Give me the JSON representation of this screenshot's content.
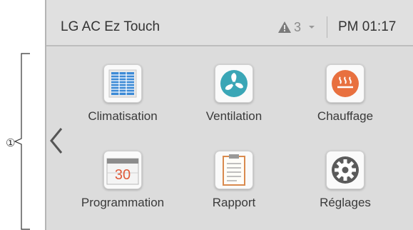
{
  "annotation": {
    "callout": "①"
  },
  "header": {
    "title": "LG AC Ez Touch",
    "alert_count": "3",
    "time": "PM 01:17"
  },
  "menu": {
    "items": [
      {
        "label": "Climatisation",
        "icon": "air-conditioner-icon"
      },
      {
        "label": "Ventilation",
        "icon": "fan-icon"
      },
      {
        "label": "Chauffage",
        "icon": "heating-icon"
      },
      {
        "label": "Programmation",
        "icon": "calendar-icon"
      },
      {
        "label": "Rapport",
        "icon": "clipboard-report-icon"
      },
      {
        "label": "Réglages",
        "icon": "gear-icon"
      }
    ],
    "calendar_day": "30"
  },
  "colors": {
    "fan": "#3aa6b6",
    "heating": "#e8703f",
    "ac_grid": "#3c8ad6",
    "calendar_text": "#e05a3a"
  }
}
